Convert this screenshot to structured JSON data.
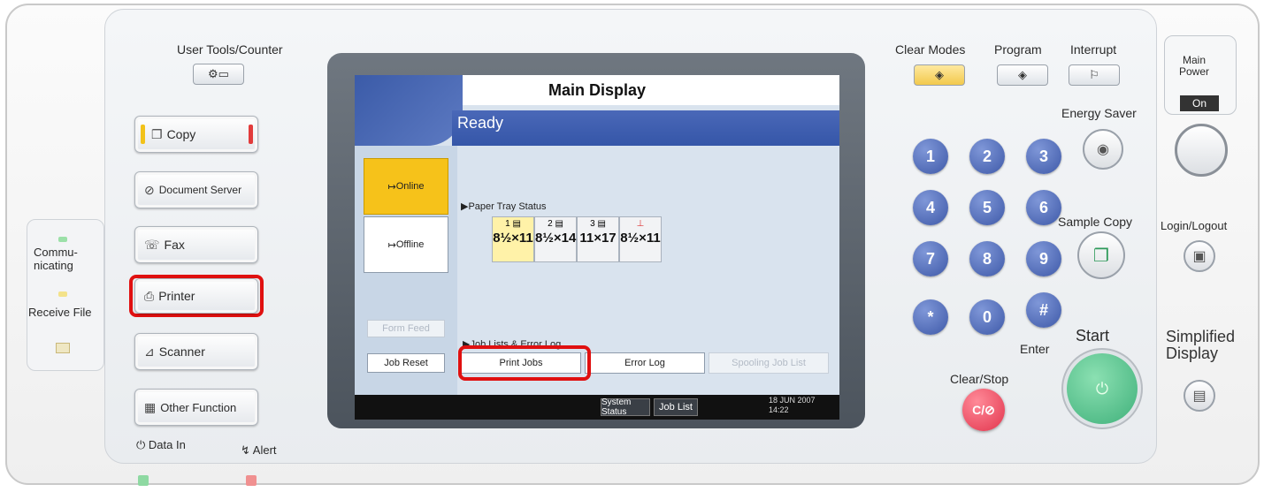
{
  "left_panel": {
    "user_tools_label": "User Tools/Counter",
    "functions": [
      {
        "label": "Copy",
        "icon": "copy-icon"
      },
      {
        "label": "Document Server",
        "icon": "document-server-icon"
      },
      {
        "label": "Fax",
        "icon": "fax-icon"
      },
      {
        "label": "Printer",
        "icon": "printer-icon"
      },
      {
        "label": "Scanner",
        "icon": "scanner-icon"
      },
      {
        "label": "Other Function",
        "icon": "other-function-icon"
      }
    ],
    "communicating_label": "Commu-\nnicating",
    "receive_file_label": "Receive File",
    "data_in_label": "Data In",
    "alert_label": "Alert"
  },
  "screen": {
    "title": "Main Display",
    "status": "Ready",
    "online_label": "Online",
    "offline_label": "Offline",
    "paper_tray_label": "Paper Tray Status",
    "trays": [
      {
        "num": "1",
        "size": "8½×11",
        "selected": true
      },
      {
        "num": "2",
        "size": "8½×14",
        "selected": false
      },
      {
        "num": "3",
        "size": "11×17",
        "selected": false
      },
      {
        "num": "",
        "size": "8½×11",
        "selected": false
      }
    ],
    "form_feed_label": "Form Feed",
    "job_reset_label": "Job Reset",
    "job_lists_label": "Job Lists & Error Log",
    "print_jobs_label": "Print Jobs",
    "error_log_label": "Error Log",
    "spooling_label": "Spooling Job List",
    "system_status_label": "System Status",
    "job_list_label": "Job List",
    "date": "18  JUN   2007",
    "time": "14:22"
  },
  "right_panel": {
    "clear_modes_label": "Clear Modes",
    "program_label": "Program",
    "interrupt_label": "Interrupt",
    "energy_saver_label": "Energy Saver",
    "sample_copy_label": "Sample Copy",
    "keys": [
      "1",
      "2",
      "3",
      "4",
      "5",
      "6",
      "7",
      "8",
      "9",
      "*",
      "0",
      "#"
    ],
    "enter_label": "Enter",
    "start_label": "Start",
    "clear_stop_label": "Clear/Stop",
    "clear_stop_glyph": "C/⊘",
    "main_power_label": "Main\nPower",
    "on_label": "On",
    "login_logout_label": "Login/Logout",
    "simplified_display_label": "Simplified\nDisplay"
  },
  "colors": {
    "highlight": "#e01010",
    "online_bg": "#f6c21a",
    "start_green": "#3fb07a",
    "clear_stop_red": "#e2354d",
    "keypad_blue": "#3e59a8"
  }
}
